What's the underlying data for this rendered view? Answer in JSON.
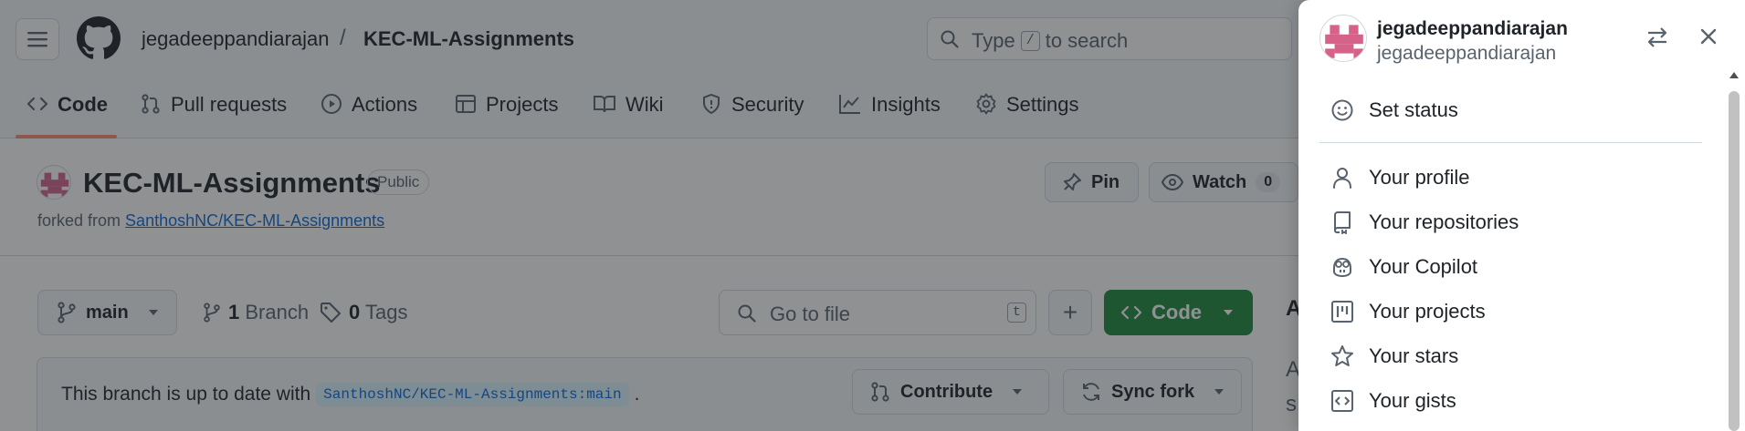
{
  "header": {
    "owner": "jegadeeppandiarajan",
    "separator": "/",
    "repo": "KEC-ML-Assignments",
    "search": {
      "before": "Type",
      "key": "/",
      "after": "to search"
    }
  },
  "tabs": [
    {
      "label": "Code",
      "icon": "code-icon"
    },
    {
      "label": "Pull requests",
      "icon": "git-pull-request-icon"
    },
    {
      "label": "Actions",
      "icon": "play-icon"
    },
    {
      "label": "Projects",
      "icon": "table-icon"
    },
    {
      "label": "Wiki",
      "icon": "book-icon"
    },
    {
      "label": "Security",
      "icon": "shield-icon"
    },
    {
      "label": "Insights",
      "icon": "graph-icon"
    },
    {
      "label": "Settings",
      "icon": "gear-icon"
    }
  ],
  "repo": {
    "title": "KEC-ML-Assignments",
    "visibility": "Public",
    "forked_prefix": "forked from",
    "forked_from": "SanthoshNC/KEC-ML-Assignments",
    "pin_label": "Pin",
    "watch_label": "Watch",
    "watch_count": "0"
  },
  "toolbar": {
    "branch": "main",
    "branches_count": "1",
    "branches_label": "Branch",
    "tags_count": "0",
    "tags_label": "Tags",
    "goto_placeholder": "Go to file",
    "goto_key": "t",
    "add_label": "+",
    "code_label": "Code"
  },
  "status": {
    "text": "This branch is up to date with",
    "ref": "SanthoshNC/KEC-ML-Assignments:main",
    "suffix": ".",
    "contribute_label": "Contribute",
    "sync_label": "Sync fork"
  },
  "about_peek": {
    "line1": "A",
    "line2": "A",
    "line3": "s"
  },
  "panel": {
    "login": "jegadeeppandiarajan",
    "name": "jegadeeppandiarajan",
    "items": [
      {
        "label": "Set status",
        "icon": "smiley-icon"
      },
      {
        "label": "Your profile",
        "icon": "person-icon"
      },
      {
        "label": "Your repositories",
        "icon": "repo-icon"
      },
      {
        "label": "Your Copilot",
        "icon": "copilot-icon"
      },
      {
        "label": "Your projects",
        "icon": "project-icon"
      },
      {
        "label": "Your stars",
        "icon": "star-icon"
      },
      {
        "label": "Your gists",
        "icon": "code-square-icon"
      }
    ]
  },
  "colors": {
    "accent_green": "#1f883d",
    "tab_underline": "#fd8c73",
    "link": "#0969da",
    "avatar_pink": "#d6628a"
  }
}
